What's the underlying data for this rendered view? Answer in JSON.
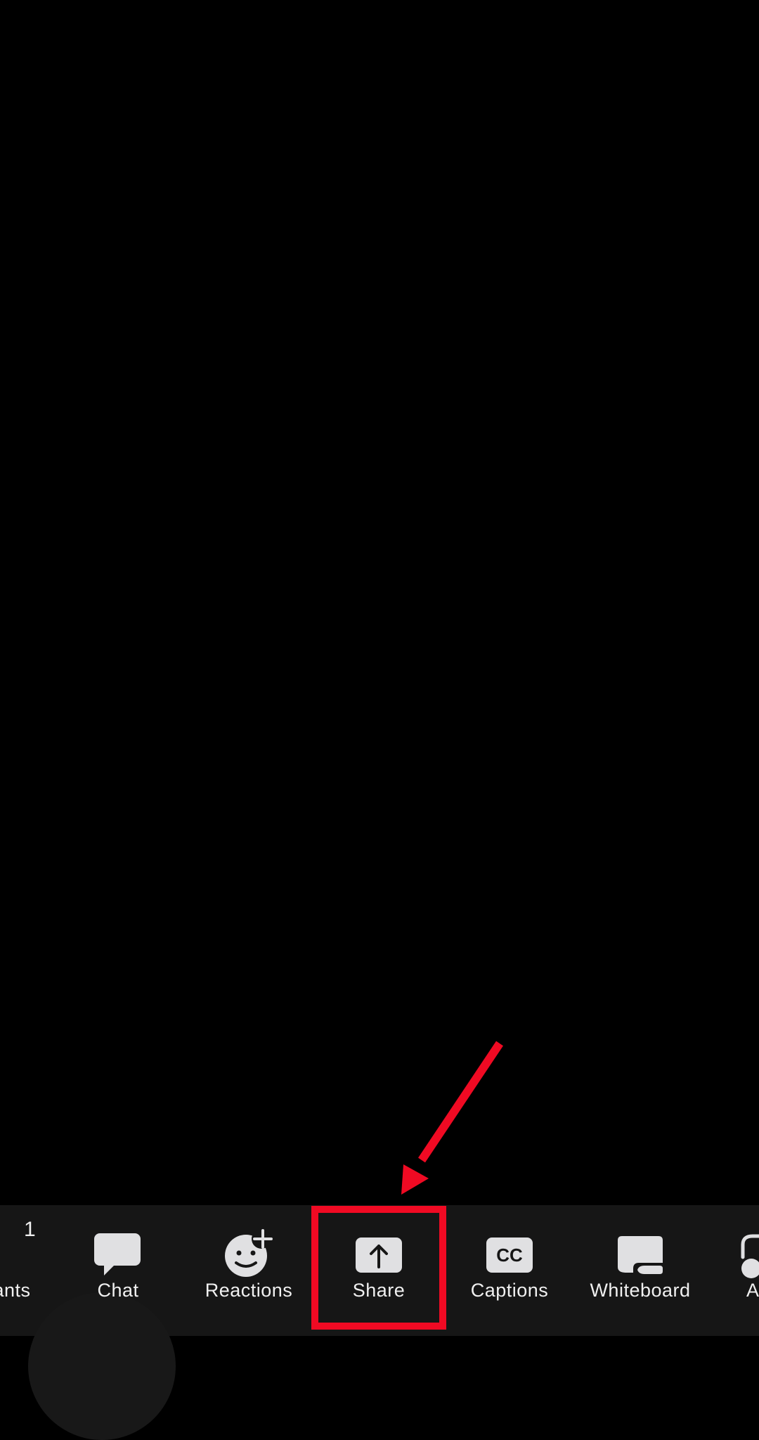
{
  "meeting": {
    "video_area": "empty",
    "toolbar": {
      "items": [
        {
          "id": "participants",
          "label": "Participants",
          "visible_label": "pants",
          "icon": "participants-icon",
          "badge": "1"
        },
        {
          "id": "chat",
          "label": "Chat",
          "icon": "chat-bubble-icon"
        },
        {
          "id": "reactions",
          "label": "Reactions",
          "icon": "emoji-add-icon"
        },
        {
          "id": "share",
          "label": "Share",
          "icon": "share-screen-icon",
          "highlighted": true
        },
        {
          "id": "captions",
          "label": "Captions",
          "icon": "closed-captions-icon",
          "icon_text": "CC"
        },
        {
          "id": "whiteboard",
          "label": "Whiteboard",
          "icon": "whiteboard-icon"
        },
        {
          "id": "apps",
          "visible_label": "A",
          "icon": "apps-icon"
        }
      ]
    }
  },
  "annotation": {
    "type": "arrow-and-box",
    "target": "share",
    "color": "#f00a23"
  },
  "colors": {
    "background": "#000000",
    "toolbar": "#161616",
    "icon": "#e0e0e2",
    "label": "#f0f0f0",
    "annotation": "#f00a23"
  }
}
